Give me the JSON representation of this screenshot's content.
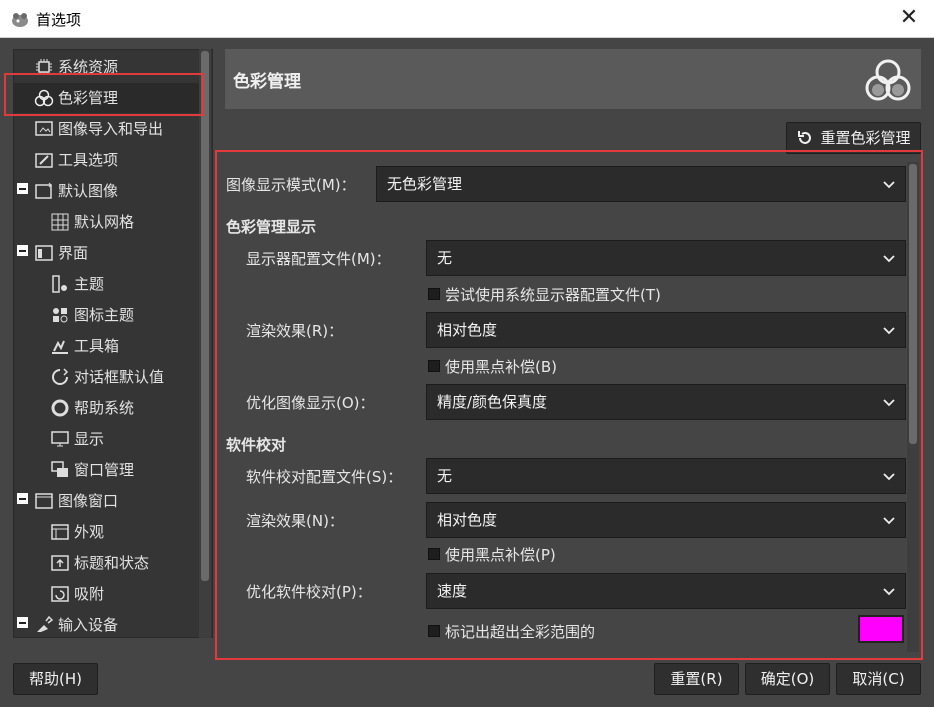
{
  "window": {
    "title": "首选项",
    "close_glyph": "✕"
  },
  "sidebar": {
    "items": [
      {
        "label": "系统资源",
        "icon": "chip-icon"
      },
      {
        "label": "色彩管理",
        "icon": "color-circles-icon"
      },
      {
        "label": "图像导入和导出",
        "icon": "image-import-export-icon"
      },
      {
        "label": "工具选项",
        "icon": "tool-options-icon"
      },
      {
        "label": "默认图像",
        "icon": "default-image-icon"
      },
      {
        "label": "默认网格",
        "icon": "grid-icon"
      },
      {
        "label": "界面",
        "icon": "interface-icon"
      },
      {
        "label": "主题",
        "icon": "theme-icon"
      },
      {
        "label": "图标主题",
        "icon": "icon-theme-icon"
      },
      {
        "label": "工具箱",
        "icon": "toolbox-icon"
      },
      {
        "label": "对话框默认值",
        "icon": "dialog-defaults-icon"
      },
      {
        "label": "帮助系统",
        "icon": "help-lifebuoy-icon"
      },
      {
        "label": "显示",
        "icon": "display-icon"
      },
      {
        "label": "窗口管理",
        "icon": "window-management-icon"
      },
      {
        "label": "图像窗口",
        "icon": "image-window-icon"
      },
      {
        "label": "外观",
        "icon": "appearance-icon"
      },
      {
        "label": "标题和状态",
        "icon": "title-status-icon"
      },
      {
        "label": "吸附",
        "icon": "snap-icon"
      },
      {
        "label": "输入设备",
        "icon": "input-devices-icon"
      }
    ]
  },
  "header": {
    "title": "色彩管理",
    "icon": "color-circles-icon"
  },
  "reset_color_button": {
    "label": "重置色彩管理",
    "icon": "reset-icon"
  },
  "form": {
    "display_mode": {
      "label": "图像显示模式(M)：",
      "value": "无色彩管理"
    },
    "section_display": "色彩管理显示",
    "monitor_profile": {
      "label": "显示器配置文件(M)：",
      "value": "无"
    },
    "try_system_profile": {
      "label": "尝试使用系统显示器配置文件(T)",
      "checked": false
    },
    "render_intent": {
      "label": "渲染效果(R)：",
      "value": "相对色度"
    },
    "black_point": {
      "label": "使用黑点补偿(B)",
      "checked": false
    },
    "optimize_display": {
      "label": "优化图像显示(O)：",
      "value": "精度/颜色保真度"
    },
    "section_softproof": "软件校对",
    "softproof_profile": {
      "label": "软件校对配置文件(S)：",
      "value": "无"
    },
    "softproof_intent": {
      "label": "渲染效果(N)：",
      "value": "相对色度"
    },
    "softproof_black_point": {
      "label": "使用黑点补偿(P)",
      "checked": false
    },
    "optimize_softproof": {
      "label": "优化软件校对(P)：",
      "value": "速度"
    },
    "mark_out_of_gamut": {
      "label": "标记出超出全彩范围的",
      "checked": false,
      "color": "#ff00ff"
    }
  },
  "footer": {
    "help": "帮助(H)",
    "reset": "重置(R)",
    "ok": "确定(O)",
    "cancel": "取消(C)"
  },
  "colors": {
    "highlight": "#e23a3a",
    "gamut_swatch": "#ff00ff"
  }
}
